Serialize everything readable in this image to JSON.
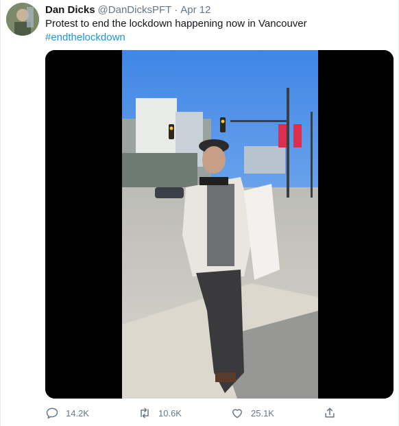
{
  "tweet": {
    "display_name": "Dan Dicks",
    "handle": "@DanDicksPFT",
    "separator": "·",
    "date": "Apr 12",
    "text": "Protest to end the lockdown happening now in Vancouver",
    "hashtag": "#endthelockdown",
    "media": {
      "type": "video",
      "description_icon": "video-frame"
    }
  },
  "actions": {
    "reply": {
      "icon": "reply-icon",
      "count": "14.2K"
    },
    "retweet": {
      "icon": "retweet-icon",
      "count": "10.6K"
    },
    "like": {
      "icon": "heart-icon",
      "count": "25.1K"
    },
    "share": {
      "icon": "share-icon"
    }
  },
  "colors": {
    "link": "#1b95e0",
    "secondary_text": "#657786",
    "primary_text": "#14171a",
    "sky": "#5b9be8"
  }
}
